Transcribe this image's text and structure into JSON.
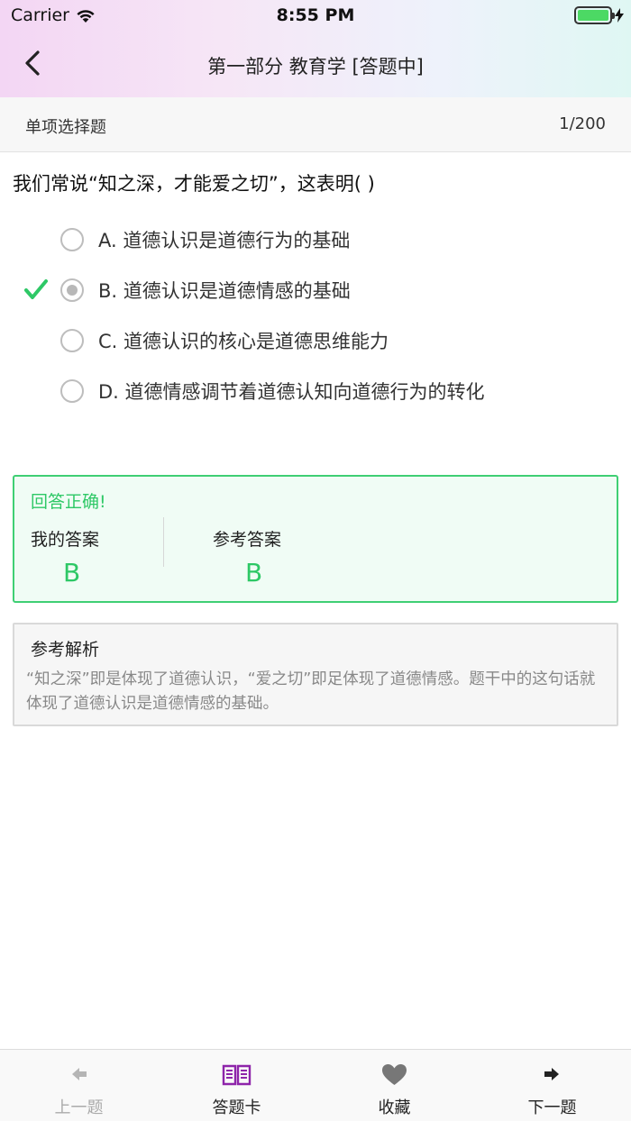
{
  "status_bar": {
    "carrier": "Carrier",
    "time": "8:55 PM",
    "wifi_icon": "wifi-icon",
    "battery_icon": "battery-icon",
    "battery_level": 1.0
  },
  "nav": {
    "title": "第一部分 教育学 [答题中]",
    "back_icon": "chevron-left-icon"
  },
  "section": {
    "type": "单项选择题",
    "count": "1/200"
  },
  "question": {
    "text": "我们常说“知之深，才能爱之切”，这表明(    )"
  },
  "options": [
    {
      "label": "A. 道德认识是道德行为的基础",
      "selected": false,
      "correct": false
    },
    {
      "label": "B. 道德认识是道德情感的基础",
      "selected": true,
      "correct": true
    },
    {
      "label": "C. 道德认识的核心是道德思维能力",
      "selected": false,
      "correct": false
    },
    {
      "label": "D. 道德情感调节着道德认知向道德行为的转化",
      "selected": false,
      "correct": false
    }
  ],
  "result": {
    "title": "回答正确!",
    "my_answer_label": "我的答案",
    "my_answer": "B",
    "ref_answer_label": "参考答案",
    "ref_answer": "B"
  },
  "analysis": {
    "title": "参考解析",
    "text": "“知之深”即是体现了道德认识，“爱之切”即足体现了道德情感。题干中的这句话就体现了道德认识是道德情感的基础。"
  },
  "tabs": [
    {
      "label": "上一题",
      "icon": "arrow-left-icon",
      "enabled": false
    },
    {
      "label": "答题卡",
      "icon": "open-book-icon",
      "enabled": true
    },
    {
      "label": "收藏",
      "icon": "heart-icon",
      "enabled": true
    },
    {
      "label": "下一题",
      "icon": "arrow-right-icon",
      "enabled": true
    }
  ],
  "colors": {
    "correct_green": "#2ec866",
    "accent_purple": "#8e24aa",
    "disabled_gray": "#aaaaaa"
  }
}
